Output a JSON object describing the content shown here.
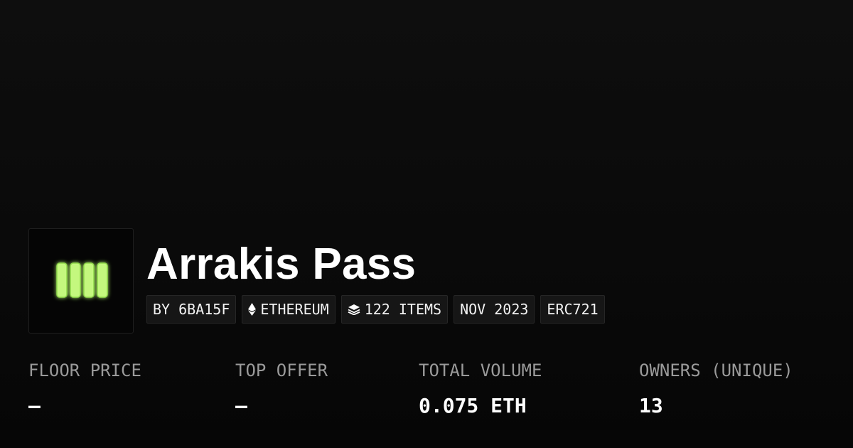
{
  "collection": {
    "title": "Arrakis Pass",
    "logo_color": "#c4f87e"
  },
  "badges": {
    "creator": "BY 6BA15F",
    "chain": "ETHEREUM",
    "items": "122 ITEMS",
    "date": "NOV 2023",
    "standard": "ERC721"
  },
  "stats": {
    "floor_price": {
      "label": "FLOOR PRICE",
      "value": "–"
    },
    "top_offer": {
      "label": "TOP OFFER",
      "value": "–"
    },
    "total_volume": {
      "label": "TOTAL VOLUME",
      "value": "0.075 ETH"
    },
    "owners": {
      "label": "OWNERS (UNIQUE)",
      "value": "13"
    }
  }
}
